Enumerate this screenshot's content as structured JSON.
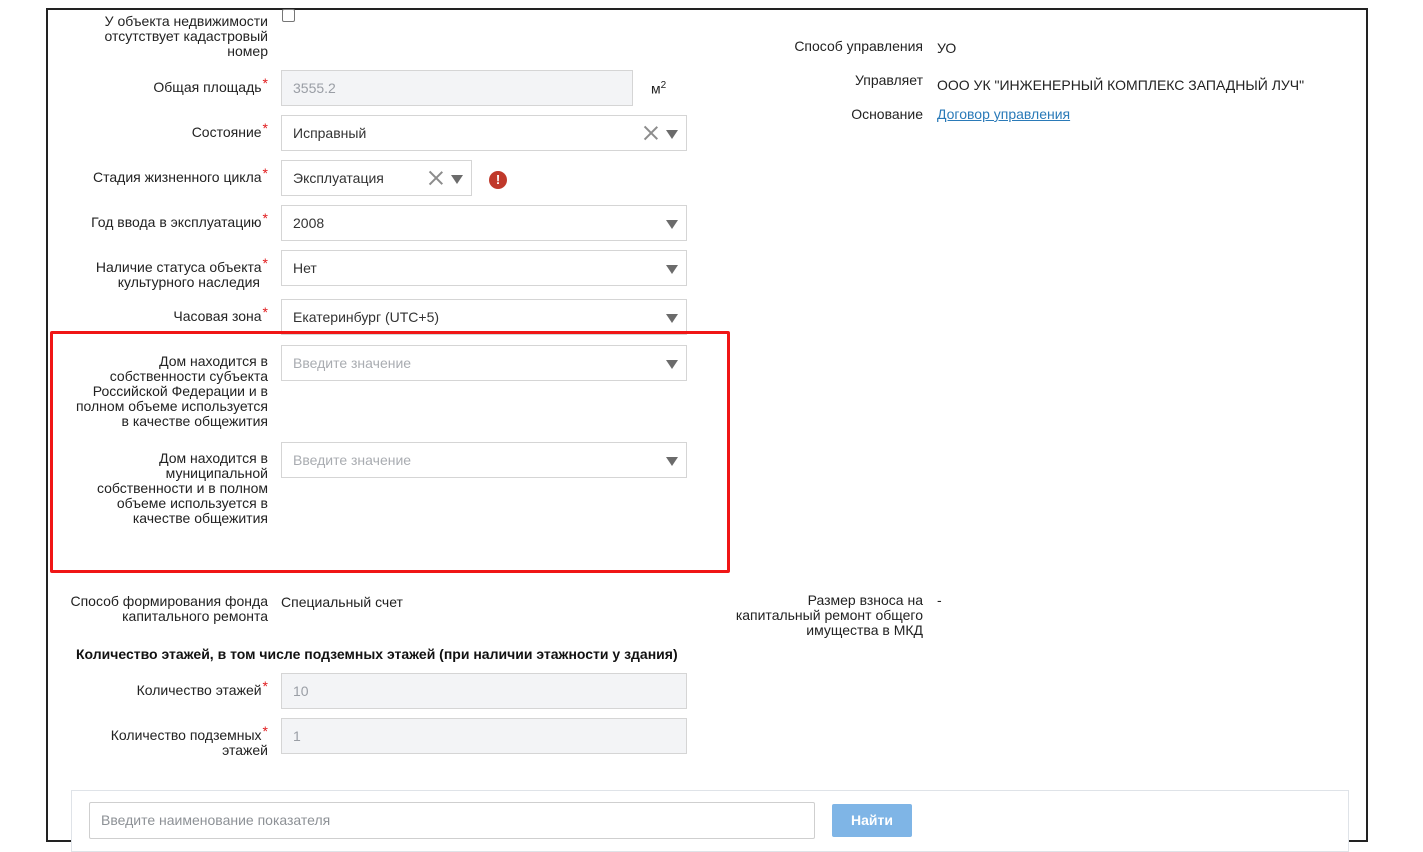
{
  "left": {
    "no_cadastral": {
      "label_l1": "У объекта недвижимости",
      "label_l2": "отсутствует кадастровый",
      "label_l3": "номер"
    },
    "area": {
      "label": "Общая площадь",
      "value": "3555.2",
      "unit": "м",
      "unit_sup": "2"
    },
    "state": {
      "label": "Состояние",
      "value": "Исправный"
    },
    "lifecycle": {
      "label": "Стадия жизненного цикла",
      "value": "Эксплуатация",
      "warning": "!"
    },
    "year": {
      "label": "Год ввода в эксплуатацию",
      "value": "2008"
    },
    "heritage": {
      "label_l1": "Наличие статуса объекта",
      "label_l2": "культурного наследия",
      "value": "Нет"
    },
    "timezone": {
      "label": "Часовая зона",
      "value": "Екатеринбург (UTC+5)"
    },
    "federal_dorm": {
      "label_l1": "Дом находится в",
      "label_l2": "собственности субъекта",
      "label_l3": "Российской Федерации и в",
      "label_l4": "полном объеме используется",
      "label_l5": "в качестве общежития",
      "placeholder": "Введите значение"
    },
    "municipal_dorm": {
      "label_l1": "Дом находится в",
      "label_l2": "муниципальной",
      "label_l3": "собственности и в полном",
      "label_l4": "объеме используется в",
      "label_l5": "качестве общежития",
      "placeholder": "Введите значение"
    },
    "fund": {
      "label_l1": "Способ формирования фонда",
      "label_l2": "капитального ремонта",
      "value": "Специальный счет"
    }
  },
  "right": {
    "management": {
      "label": "Способ управления",
      "value": "УО"
    },
    "manager": {
      "label": "Управляет",
      "value": "ООО УК \"ИНЖЕНЕРНЫЙ КОМПЛЕКС ЗАПАДНЫЙ ЛУЧ\""
    },
    "basis": {
      "label": "Основание",
      "value": "Договор управления"
    },
    "contribution": {
      "label_l1": "Размер взноса на",
      "label_l2": "капитальный ремонт общего",
      "label_l3": "имущества в МКД",
      "value": "-"
    }
  },
  "floors": {
    "section_title": "Количество этажей, в том числе подземных этажей (при наличии этажности у здания)",
    "floors": {
      "label": "Количество этажей",
      "value": "10"
    },
    "underground": {
      "label_l1": "Количество подземных",
      "label_l2": "этажей",
      "value": "1"
    }
  },
  "search": {
    "placeholder": "Введите наименование показателя",
    "button": "Найти"
  },
  "colors": {
    "required": "#e0191b",
    "highlight": "#f01616",
    "link": "#2a7ab8",
    "button": "#7fb5e6"
  }
}
